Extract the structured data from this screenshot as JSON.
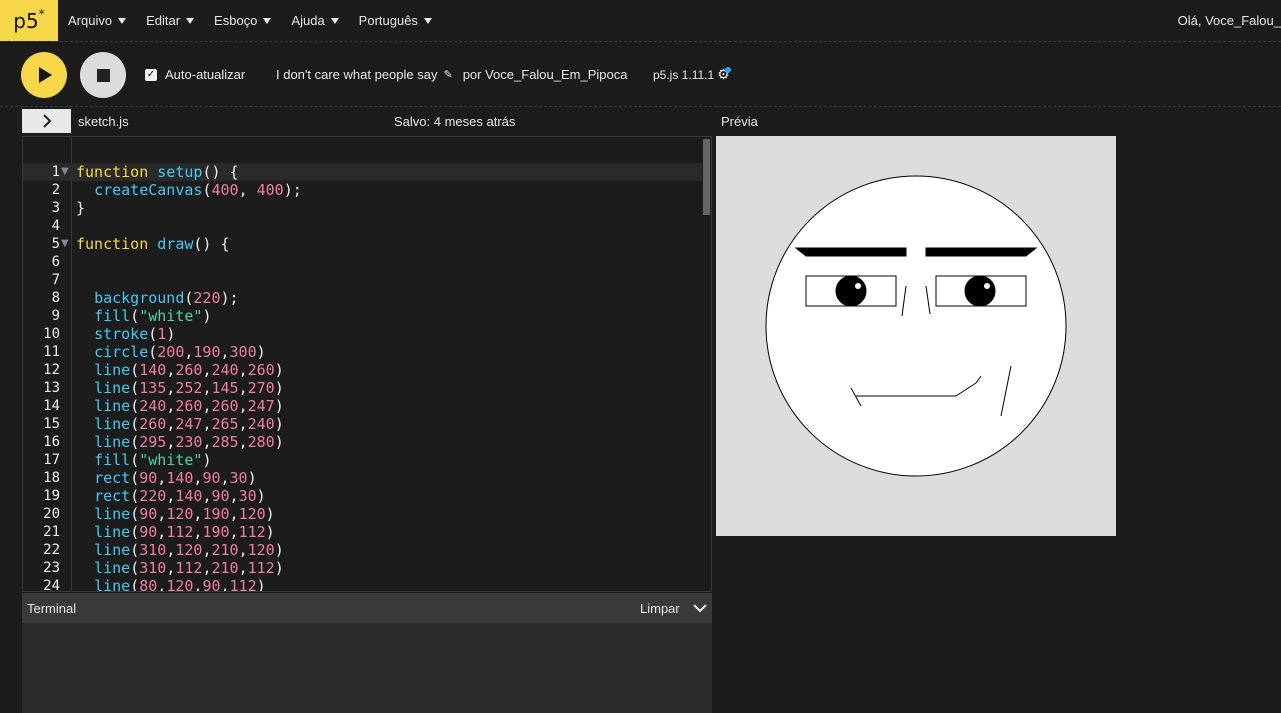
{
  "nav": {
    "logo_text": "p5",
    "logo_sup": "*",
    "menu": [
      "Arquivo",
      "Editar",
      "Esboço",
      "Ajuda",
      "Português"
    ],
    "greeting": "Olá, Voce_Falou_"
  },
  "toolbar": {
    "play_icon": "play-icon",
    "stop_icon": "stop-icon",
    "auto_refresh_label": "Auto-atualizar",
    "auto_refresh_checked": true,
    "sketch_name": "I don't care what people say",
    "author": "por Voce_Falou_Em_Pipoca",
    "version": "p5.js 1.11.1"
  },
  "editor": {
    "file_name": "sketch.js",
    "saved_status": "Salvo: 4 meses atrás",
    "active_line": 1,
    "lines": [
      {
        "n": "1",
        "fold": true
      },
      {
        "n": "2"
      },
      {
        "n": "3"
      },
      {
        "n": "4"
      },
      {
        "n": "5",
        "fold": true
      },
      {
        "n": "6"
      },
      {
        "n": "7"
      },
      {
        "n": "8"
      },
      {
        "n": "9"
      },
      {
        "n": "10"
      },
      {
        "n": "11"
      },
      {
        "n": "12"
      },
      {
        "n": "13"
      },
      {
        "n": "14"
      },
      {
        "n": "15"
      },
      {
        "n": "16"
      },
      {
        "n": "17"
      },
      {
        "n": "18"
      },
      {
        "n": "19"
      },
      {
        "n": "20"
      },
      {
        "n": "21"
      },
      {
        "n": "22"
      },
      {
        "n": "23"
      },
      {
        "n": "24"
      }
    ],
    "code": [
      "function setup() {",
      "  createCanvas(400, 400);",
      "}",
      "",
      "function draw() {",
      "",
      "",
      "  background(220);",
      "  fill(\"white\")",
      "  stroke(1)",
      "  circle(200,190,300)",
      "  line(140,260,240,260)",
      "  line(135,252,145,270)",
      "  line(240,260,260,247)",
      "  line(260,247,265,240)",
      "  line(295,230,285,280)",
      "  fill(\"white\")",
      "  rect(90,140,90,30)",
      "  rect(220,140,90,30)",
      "  line(90,120,190,120)",
      "  line(90,112,190,112)",
      "  line(310,120,210,120)",
      "  line(310,112,210,112)",
      "  line(80,120,90,112)"
    ]
  },
  "preview": {
    "label": "Prévia"
  },
  "terminal": {
    "title": "Terminal",
    "clear_label": "Limpar"
  },
  "colors": {
    "accent": "#f6d74a",
    "background": "#1c1c1c",
    "keyword": "#f6d74a",
    "function": "#41ccf5",
    "number": "#f07ea6",
    "string": "#4fd4a2",
    "notification": "#1ea7fd"
  }
}
